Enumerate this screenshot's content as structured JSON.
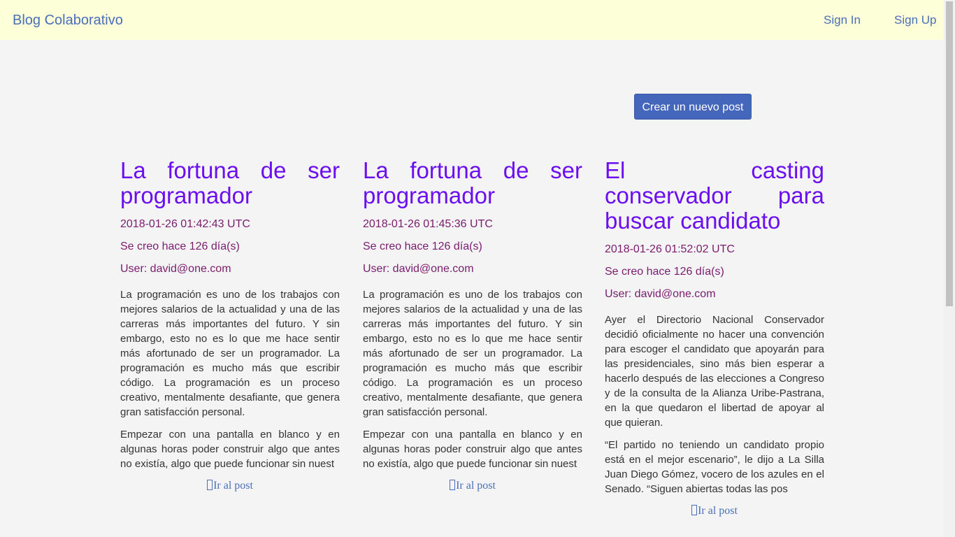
{
  "navbar": {
    "brand": "Blog Colaborativo",
    "sign_in": "Sign In",
    "sign_up": "Sign Up"
  },
  "actions": {
    "create_post": "Crear un nuevo post"
  },
  "posts": [
    {
      "title": "La fortuna de ser programador",
      "timestamp": "2018-01-26 01:42:43 UTC",
      "age": "Se creo hace 126 día(s)",
      "user": "User: david@one.com",
      "paragraphs": [
        "La programación es uno de los trabajos con mejores salarios de la actualidad y una de las carreras más importantes del futuro. Y sin embargo, esto no es lo que me hace sentir más afortunado de ser un programador. La programación es mucho más que escribir código. La programación es un proceso creativo, mentalmente desafiante, que genera gran satisfacción personal.",
        "Empezar con una pantalla en blanco y en algunas horas poder construir algo que antes no existía, algo que puede funcionar sin nuest"
      ],
      "link": "Ir al post"
    },
    {
      "title": "La fortuna de ser programador",
      "timestamp": "2018-01-26 01:45:36 UTC",
      "age": "Se creo hace 126 día(s)",
      "user": "User: david@one.com",
      "paragraphs": [
        "La programación es uno de los trabajos con mejores salarios de la actualidad y una de las carreras más importantes del futuro. Y sin embargo, esto no es lo que me hace sentir más afortunado de ser un programador. La programación es mucho más que escribir código. La programación es un proceso creativo, mentalmente desafiante, que genera gran satisfacción personal.",
        "Empezar con una pantalla en blanco y en algunas horas poder construir algo que antes no existía, algo que puede funcionar sin nuest"
      ],
      "link": "Ir al post"
    },
    {
      "title": "El casting conservador para buscar candidato",
      "timestamp": "2018-01-26 01:52:02 UTC",
      "age": "Se creo hace 126 día(s)",
      "user": "User: david@one.com",
      "paragraphs": [
        "Ayer el Directorio Nacional Conservador decidió oficialmente no hacer una convención para escoger el candidato que apoyarán para las presidenciales, sino más bien esperar a hacerlo después de las elecciones a Congreso y de la consulta de la Alianza Uribe-Pastrana, en la que quedaron el libertad de apoyar al que quieran.",
        "“El partido no teniendo un candidato propio está en el mejor escenario”, le dijo a La Silla Juan Diego Gómez, vocero de los azules en el Senado. “Siguen abiertas todas las pos"
      ],
      "link": "Ir al post"
    }
  ],
  "colors": {
    "navbar_bg": "#fdffd9",
    "link": "#4a6fb8",
    "title": "#6b0ff0",
    "meta": "#7a1b6e",
    "button_bg": "#4466bb",
    "page_bg": "#f4f4f4"
  }
}
